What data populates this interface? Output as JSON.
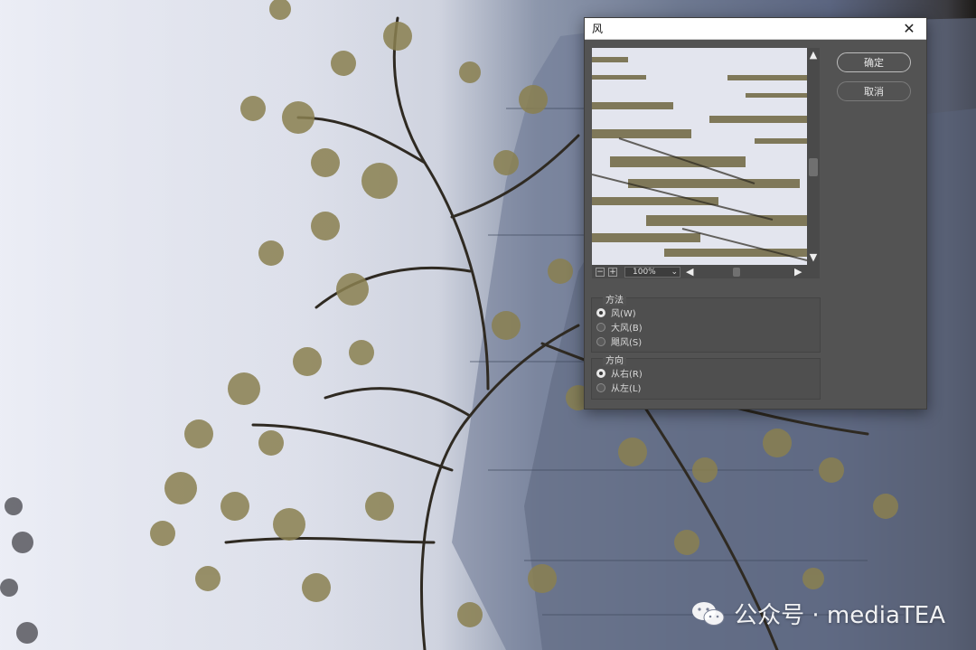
{
  "dialog": {
    "title": "风",
    "close_glyph": "✕",
    "ok_label": "确定",
    "cancel_label": "取消",
    "zoom_level": "100%",
    "zoom_out_glyph": "−",
    "zoom_in_glyph": "+",
    "method": {
      "title": "方法",
      "options": [
        "风(W)",
        "大风(B)",
        "飓风(S)"
      ],
      "selected": 0
    },
    "direction": {
      "title": "方向",
      "options": [
        "从右(R)",
        "从左(L)"
      ],
      "selected": 0
    }
  },
  "watermark": {
    "text": "公众号 · mediaTEA",
    "icon": "wechat-icon"
  },
  "colors": {
    "dialog_bg": "#535353",
    "titlebar_bg": "#ffffff",
    "sky": "#e3e5ee",
    "foliage": "#8a8050"
  }
}
